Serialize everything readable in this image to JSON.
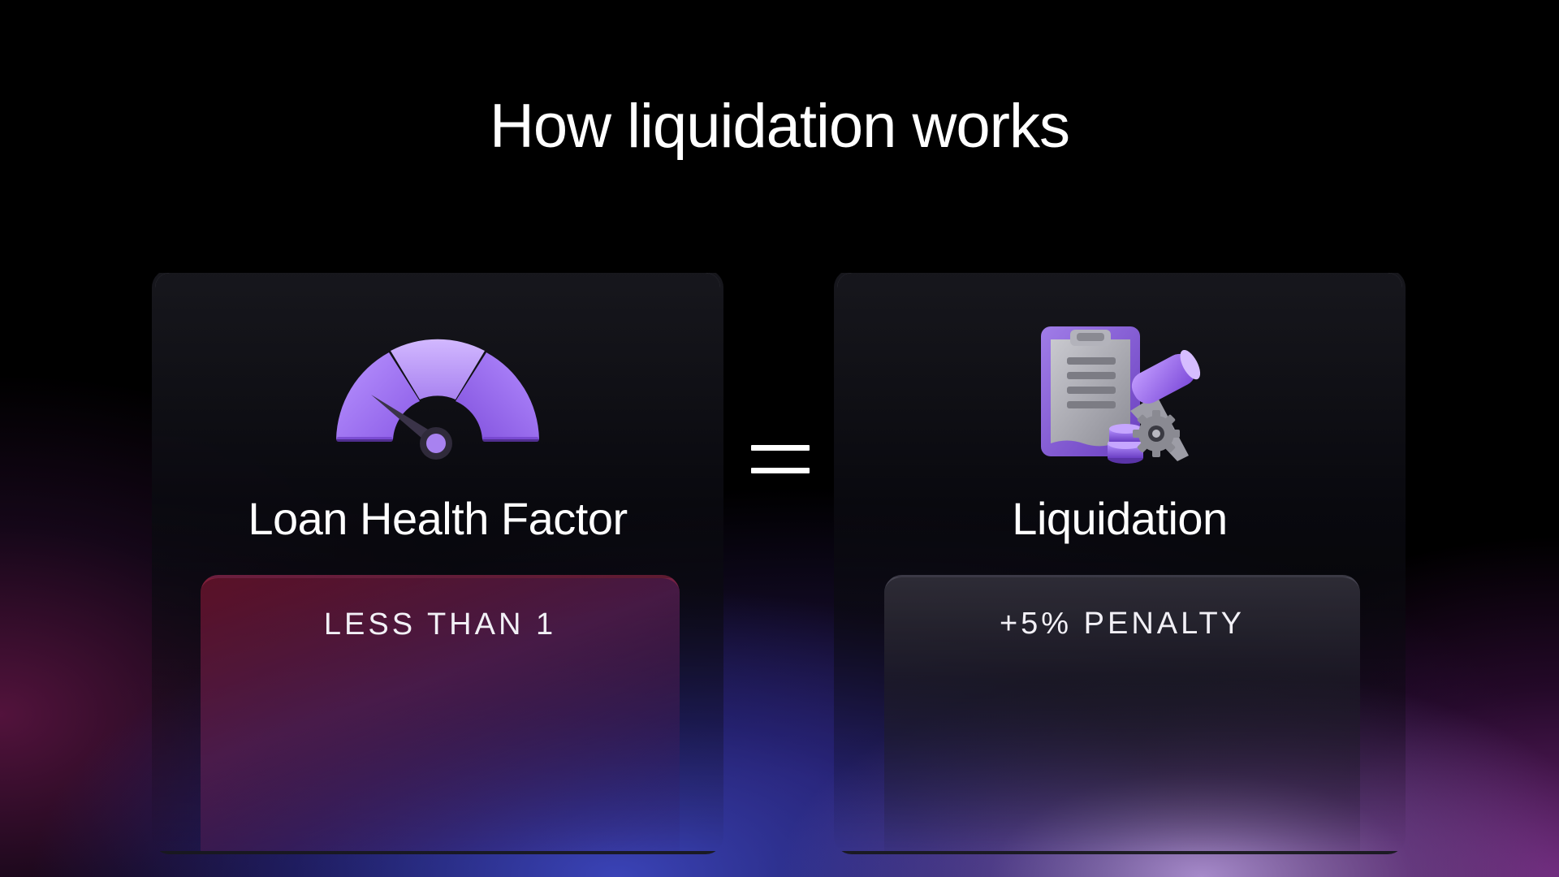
{
  "slide": {
    "title": "How liquidation works",
    "equals_symbol": "=",
    "left_card": {
      "icon": "gauge-icon",
      "label": "Loan Health Factor",
      "pill_text": "LESS THAN 1"
    },
    "right_card": {
      "icon": "clipboard-gavel-icon",
      "label": "Liquidation",
      "pill_text": "+5% PENALTY"
    }
  },
  "colors": {
    "accent_purple": "#a87ff0",
    "warning_red": "#5f1228",
    "background": "#000000",
    "text": "#ffffff"
  }
}
